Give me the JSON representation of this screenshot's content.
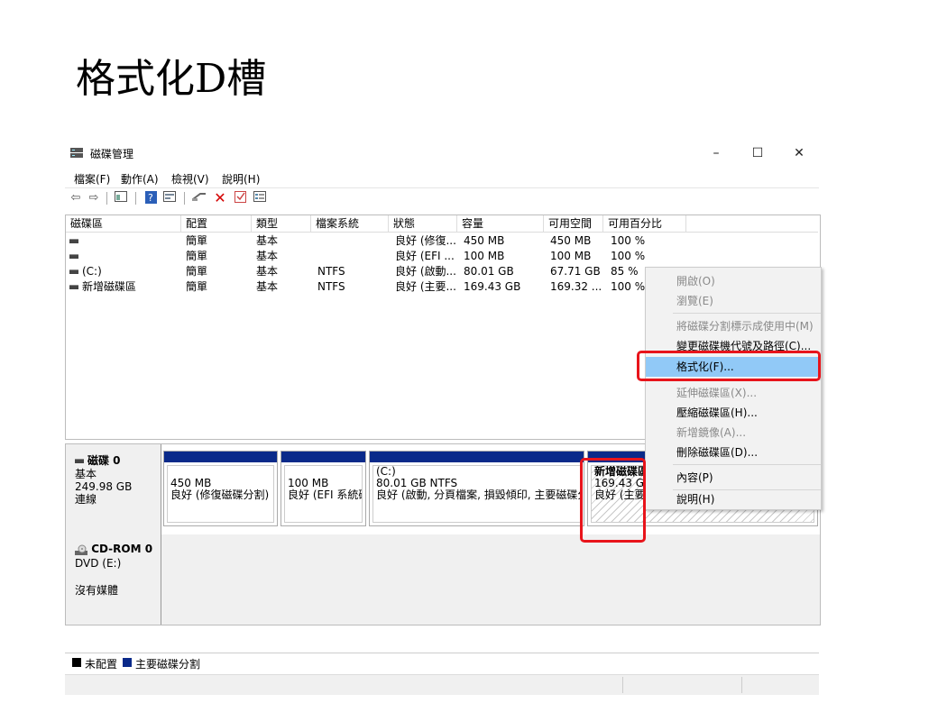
{
  "slide": {
    "title": "格式化D槽"
  },
  "window": {
    "title": "磁碟管理",
    "controls": {
      "minimize": "–",
      "maximize": "☐",
      "close": "✕"
    },
    "menus": [
      "檔案(F)",
      "動作(A)",
      "檢視(V)",
      "說明(H)"
    ]
  },
  "toolbar": {
    "icons": [
      "back-icon",
      "forward-icon",
      "console-tree-icon",
      "help-icon",
      "properties-icon",
      "connect-icon",
      "delete-icon",
      "check-icon",
      "list-view-icon"
    ]
  },
  "volume_table": {
    "columns": [
      "磁碟區",
      "配置",
      "類型",
      "檔案系統",
      "狀態",
      "容量",
      "可用空間",
      "可用百分比"
    ],
    "rows": [
      [
        "",
        "簡單",
        "基本",
        "",
        "良好 (修復...",
        "450 MB",
        "450 MB",
        "100 %"
      ],
      [
        "",
        "簡單",
        "基本",
        "",
        "良好 (EFI ...",
        "100 MB",
        "100 MB",
        "100 %"
      ],
      [
        "(C:)",
        "簡單",
        "基本",
        "NTFS",
        "良好 (啟動...",
        "80.01 GB",
        "67.71 GB",
        "85 %"
      ],
      [
        "新增磁碟區",
        "簡單",
        "基本",
        "NTFS",
        "良好 (主要...",
        "169.43 GB",
        "169.32 ...",
        "100 %"
      ]
    ]
  },
  "disk0": {
    "name": "磁碟 0",
    "type": "基本",
    "size": "249.98 GB",
    "status": "連線",
    "partitions": [
      {
        "line1": "",
        "line2": "450 MB",
        "line3": "良好 (修復磁碟分割)"
      },
      {
        "line1": "",
        "line2": "100 MB",
        "line3": "良好 (EFI 系統磁碟分割)"
      },
      {
        "line1": "(C:)",
        "line2": "80.01 GB NTFS",
        "line3": "良好 (啟動, 分頁檔案, 損毀傾印, 主要磁碟分割)"
      },
      {
        "line1": "新增磁碟區",
        "line2": "169.43 GB",
        "line3": "良好 (主要"
      }
    ]
  },
  "cdrom": {
    "name": "CD-ROM 0",
    "drive": "DVD (E:)",
    "media": "沒有媒體"
  },
  "legend": {
    "unallocated": "未配置",
    "primary": "主要磁碟分割",
    "unallocated_color": "#000000",
    "primary_color": "#0a2a8a"
  },
  "context_menu": {
    "items": [
      {
        "label": "開啟(O)",
        "enabled": false
      },
      {
        "label": "瀏覽(E)",
        "enabled": false
      },
      {
        "label": "將磁碟分割標示成使用中(M)",
        "enabled": false
      },
      {
        "label": "變更磁碟機代號及路徑(C)...",
        "enabled": true
      },
      {
        "label": "格式化(F)...",
        "enabled": true,
        "highlighted": true
      },
      {
        "label": "延伸磁碟區(X)...",
        "enabled": false
      },
      {
        "label": "壓縮磁碟區(H)...",
        "enabled": true
      },
      {
        "label": "新增鏡像(A)...",
        "enabled": false
      },
      {
        "label": "刪除磁碟區(D)...",
        "enabled": true
      },
      {
        "label": "內容(P)",
        "enabled": true
      },
      {
        "label": "說明(H)",
        "enabled": true
      }
    ]
  },
  "colors": {
    "highlight": "#91c9f7",
    "annotation_red": "#e8141b",
    "partition_bar": "#0a2a8a"
  }
}
